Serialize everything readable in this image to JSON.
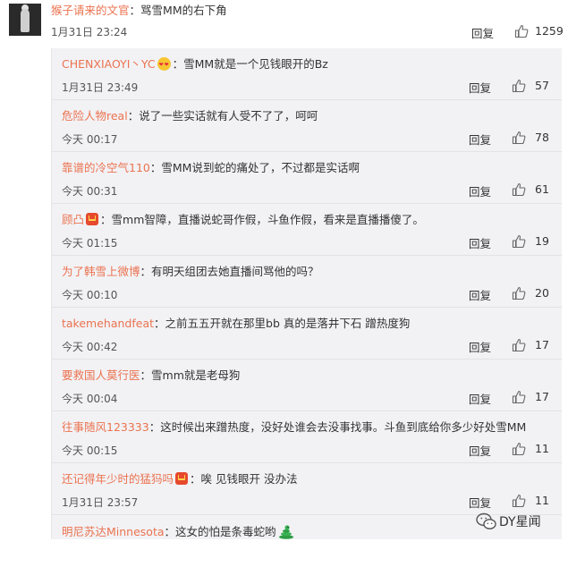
{
  "top_comment": {
    "username": "猴子请来的文官",
    "separator": "：",
    "text": "骂雪MM的右下角",
    "time": "1月31日 23:24",
    "reply_label": "回复",
    "likes": "1259"
  },
  "replies": [
    {
      "username": "CHENXIAOYI丶YC",
      "badge": "love-emoji",
      "sep": "：",
      "text": "雪MM就是一个见钱眼开的Bz",
      "time": "1月31日 23:49",
      "reply_label": "回复",
      "likes": "57"
    },
    {
      "username": "危险人物real",
      "badge": "",
      "sep": "：",
      "text": "说了一些实话就有人受不了了，呵呵",
      "time": "今天 00:17",
      "reply_label": "回复",
      "likes": "78"
    },
    {
      "username": "靠谱的冷空气110",
      "badge": "",
      "sep": "：",
      "text": "雪MM说到蛇的痛处了，不过都是实话啊",
      "time": "今天 00:31",
      "reply_label": "回复",
      "likes": "61"
    },
    {
      "username": "顾凸",
      "badge": "red-envelope",
      "sep": "：",
      "text": "雪mm智障，直播说蛇哥作假，斗鱼作假，看来是直播播傻了。",
      "time": "今天 01:15",
      "reply_label": "回复",
      "likes": "19"
    },
    {
      "username": "为了韩雪上微博",
      "badge": "",
      "sep": "：",
      "text": "有明天组团去她直播间骂他的吗？",
      "time": "今天 00:10",
      "reply_label": "回复",
      "likes": "20"
    },
    {
      "username": "takemehandfeat",
      "badge": "",
      "sep": "：",
      "text": "之前五五开就在那里bb 真的是落井下石 蹭热度狗",
      "time": "今天 00:42",
      "reply_label": "回复",
      "likes": "17"
    },
    {
      "username": "要救国人莫行医",
      "badge": "",
      "sep": "：",
      "text": "雪mm就是老母狗",
      "time": "今天 00:04",
      "reply_label": "回复",
      "likes": "17"
    },
    {
      "username": "往事随风123333",
      "badge": "",
      "sep": "：",
      "text": "这时候出来蹭热度，没好处谁会去没事找事。斗鱼到底给你多少好处雪MM",
      "time": "今天 00:15",
      "reply_label": "回复",
      "likes": "11"
    },
    {
      "username": "还记得年少时的猛犸吗",
      "badge": "red-envelope",
      "sep": "：",
      "text": "唉 见钱眼开 没办法",
      "time": "1月31日 23:57",
      "reply_label": "回复",
      "likes": "11"
    },
    {
      "username": "明尼苏达Minnesota",
      "badge": "",
      "sep": "：",
      "text": "这女的怕是条毒蛇哟",
      "suffix_icon": "snake-emoji",
      "time": "",
      "reply_label": "",
      "likes": ""
    }
  ],
  "watermark": {
    "text": "DY星闻",
    "icon": "wechat-icon"
  },
  "colors": {
    "username": "#eb7350",
    "panel_bg": "#f2f2f5",
    "text": "#333333"
  }
}
